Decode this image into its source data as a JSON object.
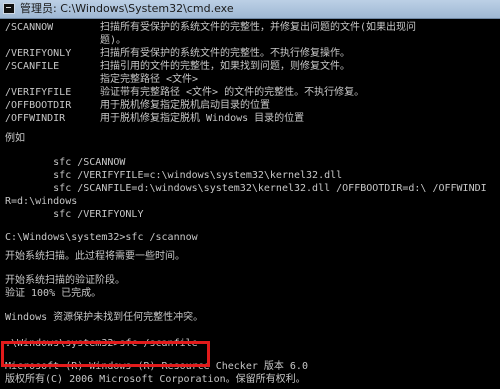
{
  "window": {
    "title": "管理员: C:\\Windows\\System32\\cmd.exe",
    "icon": "cmd-icon"
  },
  "console": {
    "options": [
      {
        "cmd": "/SCANNOW",
        "desc": "扫描所有受保护的系统文件的完整性，并修复出问题的文件(如果出现问"
      },
      {
        "cmd": "",
        "desc": "题)。"
      },
      {
        "cmd": "/VERIFYONLY",
        "desc": "扫描所有受保护的系统文件的完整性。不执行修复操作。"
      },
      {
        "cmd": "/SCANFILE",
        "desc": "扫描引用的文件的完整性，如果找到问题，则修复文件。"
      },
      {
        "cmd": "",
        "desc": "指定完整路径 <文件>"
      },
      {
        "cmd": "/VERIFYFILE",
        "desc": "验证带有完整路径 <文件> 的文件的完整性。不执行修复。"
      },
      {
        "cmd": "/OFFBOOTDIR",
        "desc": "用于脱机修复指定脱机启动目录的位置"
      },
      {
        "cmd": "/OFFWINDIR",
        "desc": "用于脱机修复指定脱机 Windows 目录的位置"
      }
    ],
    "example_heading": "例如",
    "examples": [
      "        sfc /SCANNOW",
      "        sfc /VERIFYFILE=c:\\windows\\system32\\kernel32.dll",
      "        sfc /SCANFILE=d:\\windows\\system32\\kernel32.dll /OFFBOOTDIR=d:\\ /OFFWINDI",
      "R=d:\\windows",
      "        sfc /VERIFYONLY"
    ],
    "prompt1": "C:\\Windows\\system32>sfc /scannow",
    "msg1": "开始系统扫描。此过程将需要一些时间。",
    "msg2": "开始系统扫描的验证阶段。",
    "msg3": "验证 100% 已完成。",
    "msg4": "Windows 资源保护未找到任何完整性冲突。",
    "prompt2": ":\\Windows\\system32>sfc /scanfile",
    "msg5": "Microsoft (R) Windows (R) Resource Checker 版本 6.0",
    "msg6": "版权所有(C) 2006 Microsoft Corporation。保留所有权利。"
  }
}
